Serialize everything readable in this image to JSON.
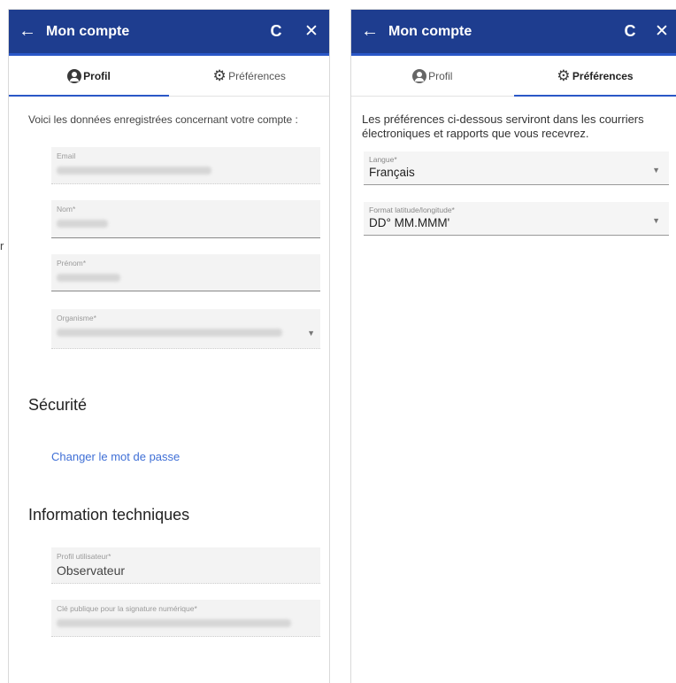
{
  "stray_char": "r",
  "left": {
    "header": {
      "back_icon": "←",
      "title": "Mon compte",
      "refresh_icon": "C",
      "close_icon": "✕"
    },
    "tabs": [
      {
        "label": "Profil",
        "active": true,
        "icon": "user-circle-icon"
      },
      {
        "label": "Préférences",
        "active": false,
        "icon": "gear-icon"
      }
    ],
    "intro": "Voici les données enregistrées concernant votre compte :",
    "fields": {
      "email": {
        "label": "Email"
      },
      "nom": {
        "label": "Nom*"
      },
      "prenom": {
        "label": "Prénom*"
      },
      "organisme": {
        "label": "Organisme*"
      }
    },
    "security": {
      "title": "Sécurité",
      "change_password": "Changer le mot de passe"
    },
    "technical": {
      "title": "Information techniques",
      "profil_label": "Profil utilisateur*",
      "profil_value": "Observateur",
      "cle_label": "Clé publique pour la signature numérique*"
    }
  },
  "right": {
    "header": {
      "back_icon": "←",
      "title": "Mon compte",
      "refresh_icon": "C",
      "close_icon": "✕"
    },
    "tabs": [
      {
        "label": "Profil",
        "active": false,
        "icon": "user-circle-icon"
      },
      {
        "label": "Préférences",
        "active": true,
        "icon": "gear-icon"
      }
    ],
    "intro": "Les préférences ci-dessous serviront dans les courriers électroniques et rapports que vous recevrez.",
    "langue": {
      "label": "Langue*",
      "value": "Français"
    },
    "format": {
      "label": "Format latitude/longitude*",
      "value": "DD° MM.MMM'"
    }
  },
  "colors": {
    "header_bg": "#1e3d8f",
    "accent": "#2a57c7",
    "link": "#3f6fd6"
  }
}
